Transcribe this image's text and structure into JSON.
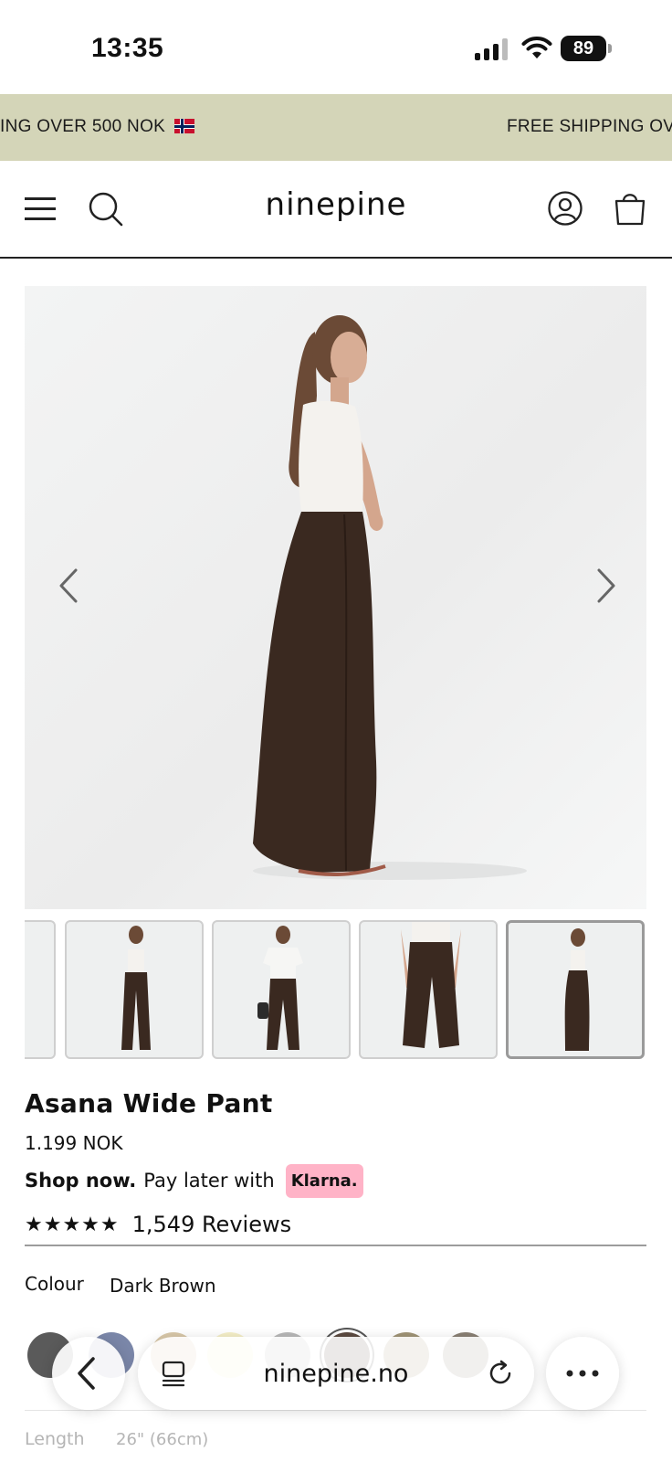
{
  "status_bar": {
    "time": "13:35",
    "battery": "89"
  },
  "announcement": {
    "segments": [
      "ING OVER 500 NOK",
      "FREE SHIPPING OV"
    ]
  },
  "header": {
    "logo": "ninepine"
  },
  "gallery": {
    "active_index": 3,
    "thumbnail_count": 4
  },
  "product": {
    "title": "Asana Wide Pant",
    "price": "1.199 NOK",
    "shop_now": "Shop now.",
    "pay_later": "Pay later with",
    "klarna": "Klarna.",
    "stars": "★★★★★",
    "reviews": "1,549 Reviews",
    "colour_label": "Colour",
    "colour_value": "Dark Brown",
    "length_label": "Length",
    "length_value": "26\" (66cm)"
  },
  "swatch_colors": [
    "#5a5a5a",
    "#7a86a8",
    "#d8c7a8",
    "#f5f0c8",
    "#b8b8b8",
    "#5c4a40",
    "#a09476",
    "#8a8074"
  ],
  "browser": {
    "url": "ninepine.no"
  }
}
